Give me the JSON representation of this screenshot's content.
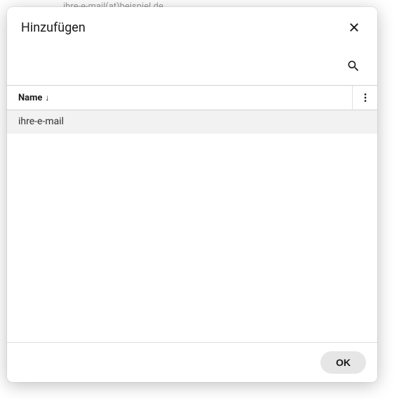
{
  "background": {
    "partial_text": "ihre-e-mail(at)beispiel.de"
  },
  "dialog": {
    "title": "Hinzufügen",
    "table": {
      "header": {
        "name_label": "Name",
        "sort_direction": "↓"
      },
      "rows": [
        {
          "name": "ihre-e-mail"
        }
      ]
    },
    "footer": {
      "ok_label": "OK"
    }
  }
}
